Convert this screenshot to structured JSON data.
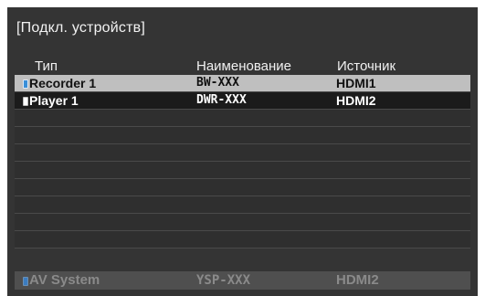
{
  "title": "[Подкл. устройств]",
  "columns": {
    "type": "Тип",
    "name": "Наименование",
    "source": "Источник"
  },
  "devices": [
    {
      "type": "Recorder 1",
      "name": "BW-XXX",
      "source": "HDMI1",
      "icon": "recorder-icon",
      "icon_color": "#3a8fd8",
      "selected": true
    },
    {
      "type": "Player 1",
      "name": "DWR-XXX",
      "source": "HDMI2",
      "icon": "player-icon",
      "icon_color": "#ffffff",
      "selected": false
    }
  ],
  "av_system": {
    "type": "AV System",
    "name": "YSP-XXX",
    "source": "HDMI2",
    "icon": "av-system-icon",
    "icon_color": "#3b7cc0"
  },
  "colors": {
    "background": "#343434",
    "selected_row": "#bfbfbf",
    "row": "#1b1b1b"
  }
}
